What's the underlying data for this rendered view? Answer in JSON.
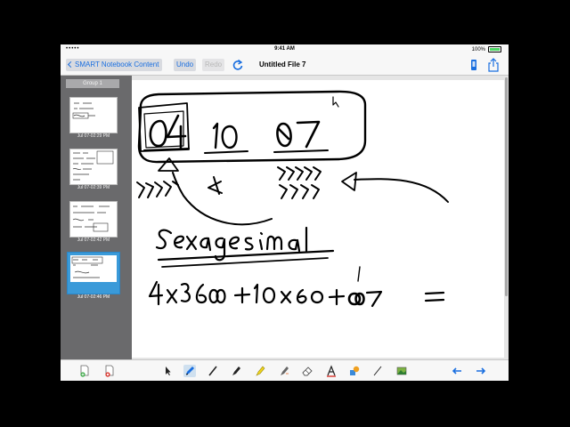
{
  "status_bar": {
    "signal": "•••••",
    "time": "9:41 AM",
    "battery": "100%"
  },
  "nav": {
    "back_label": "SMART Notebook Content",
    "undo_label": "Undo",
    "redo_label": "Redo",
    "title": "Untitled File 7",
    "refresh_icon": "refresh-icon",
    "device_icon": "device-icon",
    "share_icon": "share-icon"
  },
  "sidebar": {
    "group_label": "Group 1",
    "pages": [
      {
        "timestamp": "Jul 07-02:29 PM",
        "selected": false
      },
      {
        "timestamp": "Jul 07-02:39 PM",
        "selected": false
      },
      {
        "timestamp": "Jul 07-02:42 PM",
        "selected": false
      },
      {
        "timestamp": "Jul 07-02:46 PM",
        "selected": true
      }
    ]
  },
  "canvas": {
    "ink_color": "#000000",
    "note_line1": "04  10  07",
    "note_line2": "Sexagesimal",
    "note_line3": "4x3600+10x60+07 ="
  },
  "toolbar": {
    "items": [
      "add-page-icon",
      "delete-page-icon",
      "select-icon",
      "pen-icon",
      "calligraphic-pen-icon",
      "marker-icon",
      "highlighter-icon",
      "magic-pen-icon",
      "eraser-icon",
      "text-icon",
      "shapes-icon",
      "line-icon",
      "insert-image-icon",
      "back-arrow-icon",
      "forward-arrow-icon"
    ],
    "selected": "pen-icon",
    "accent": "#1a6fe0"
  }
}
